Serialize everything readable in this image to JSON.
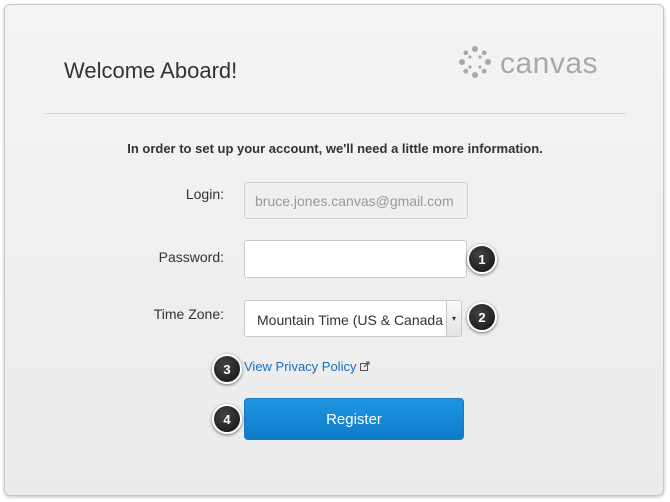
{
  "header": {
    "title": "Welcome Aboard!",
    "brand": "canvas"
  },
  "form": {
    "intro": "In order to set up your account, we'll need a little more information.",
    "login_label": "Login:",
    "login_value": "bruce.jones.canvas@gmail.com",
    "password_label": "Password:",
    "password_value": "",
    "timezone_label": "Time Zone:",
    "timezone_value": "Mountain Time (US & Canada)",
    "privacy_link": "View Privacy Policy",
    "register_label": "Register"
  },
  "callouts": [
    "1",
    "2",
    "3",
    "4"
  ],
  "colors": {
    "accent": "#1585d8",
    "link": "#1a6fbf",
    "logo": "#a9a9a9"
  },
  "icons": {
    "logo": "canvas-logo-icon",
    "external_link": "external-link-icon",
    "dropdown": "dropdown-arrow-icon"
  }
}
